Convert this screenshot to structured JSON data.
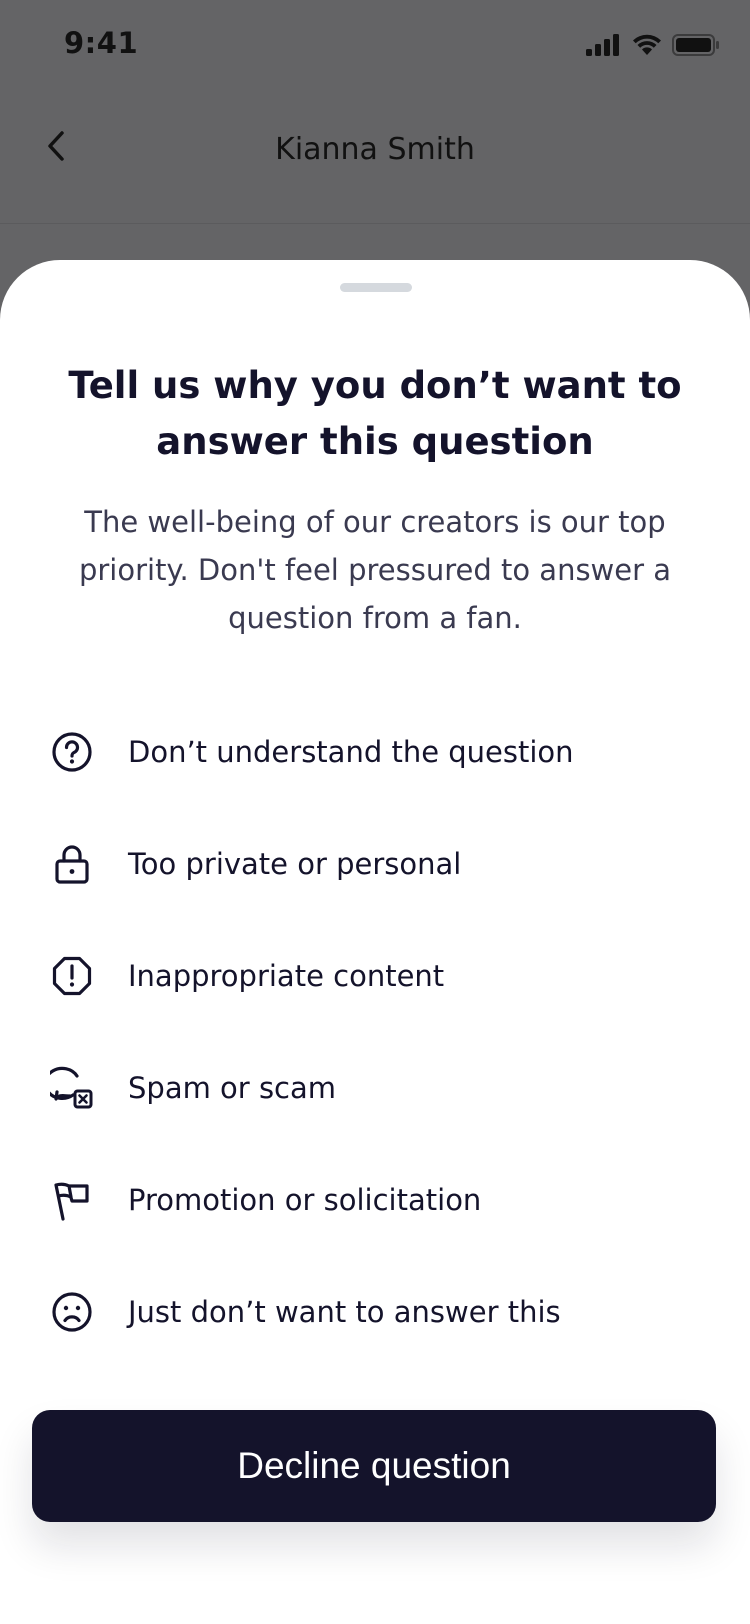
{
  "status_bar": {
    "time": "9:41",
    "icons": [
      "signal-icon",
      "wifi-icon",
      "battery-icon"
    ]
  },
  "nav": {
    "back_icon": "chevron-left-icon",
    "title": "Kianna Smith"
  },
  "sheet": {
    "title": "Tell us why you don’t want to answer this question",
    "subtitle": "The well-being of our creators is our top priority. Don't feel pressured to answer a question from a fan.",
    "reasons": [
      {
        "icon": "question-circle-icon",
        "label": "Don’t understand the question"
      },
      {
        "icon": "lock-icon",
        "label": "Too private or personal"
      },
      {
        "icon": "alert-octagon-icon",
        "label": "Inappropriate content"
      },
      {
        "icon": "chat-block-icon",
        "label": "Spam or scam"
      },
      {
        "icon": "flag-icon",
        "label": "Promotion or solicitation"
      },
      {
        "icon": "sad-face-icon",
        "label": "Just don’t want to answer this"
      }
    ],
    "decline_label": "Decline question"
  },
  "colors": {
    "overlay": "#646466",
    "primary": "#14132b",
    "text_secondary": "#3a3a50",
    "grabber": "#d5d9de"
  }
}
